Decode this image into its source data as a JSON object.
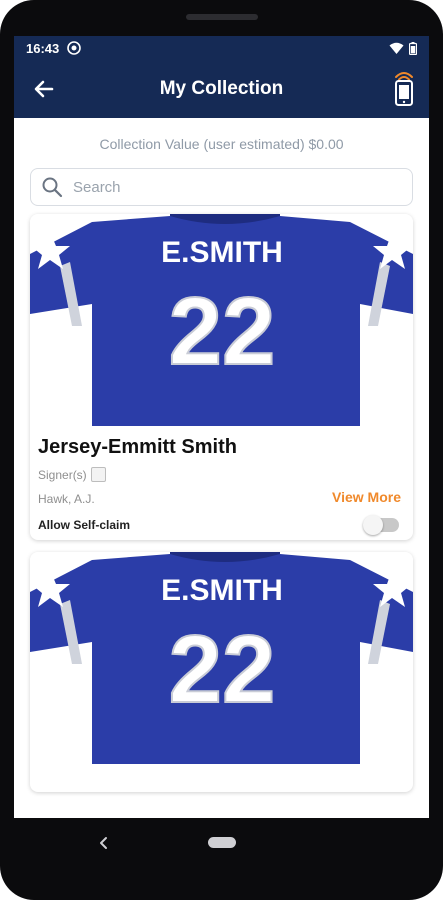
{
  "status": {
    "time": "16:43"
  },
  "header": {
    "title": "My Collection"
  },
  "collection": {
    "value_text": "Collection Value (user estimated) $0.00"
  },
  "search": {
    "placeholder": "Search"
  },
  "items": [
    {
      "title": "Jersey-Emmitt Smith",
      "jersey_name": "E.SMITH",
      "jersey_number": "22",
      "signers_label": "Signer(s)",
      "signer_name": "Hawk, A.J.",
      "view_more_label": "View More",
      "self_claim_label": "Allow Self-claim",
      "self_claim_enabled": false
    },
    {
      "jersey_name": "E.SMITH",
      "jersey_number": "22"
    }
  ],
  "colors": {
    "header_bg": "#152a55",
    "jersey_blue": "#2b3da8",
    "accent_orange": "#f0892b"
  }
}
